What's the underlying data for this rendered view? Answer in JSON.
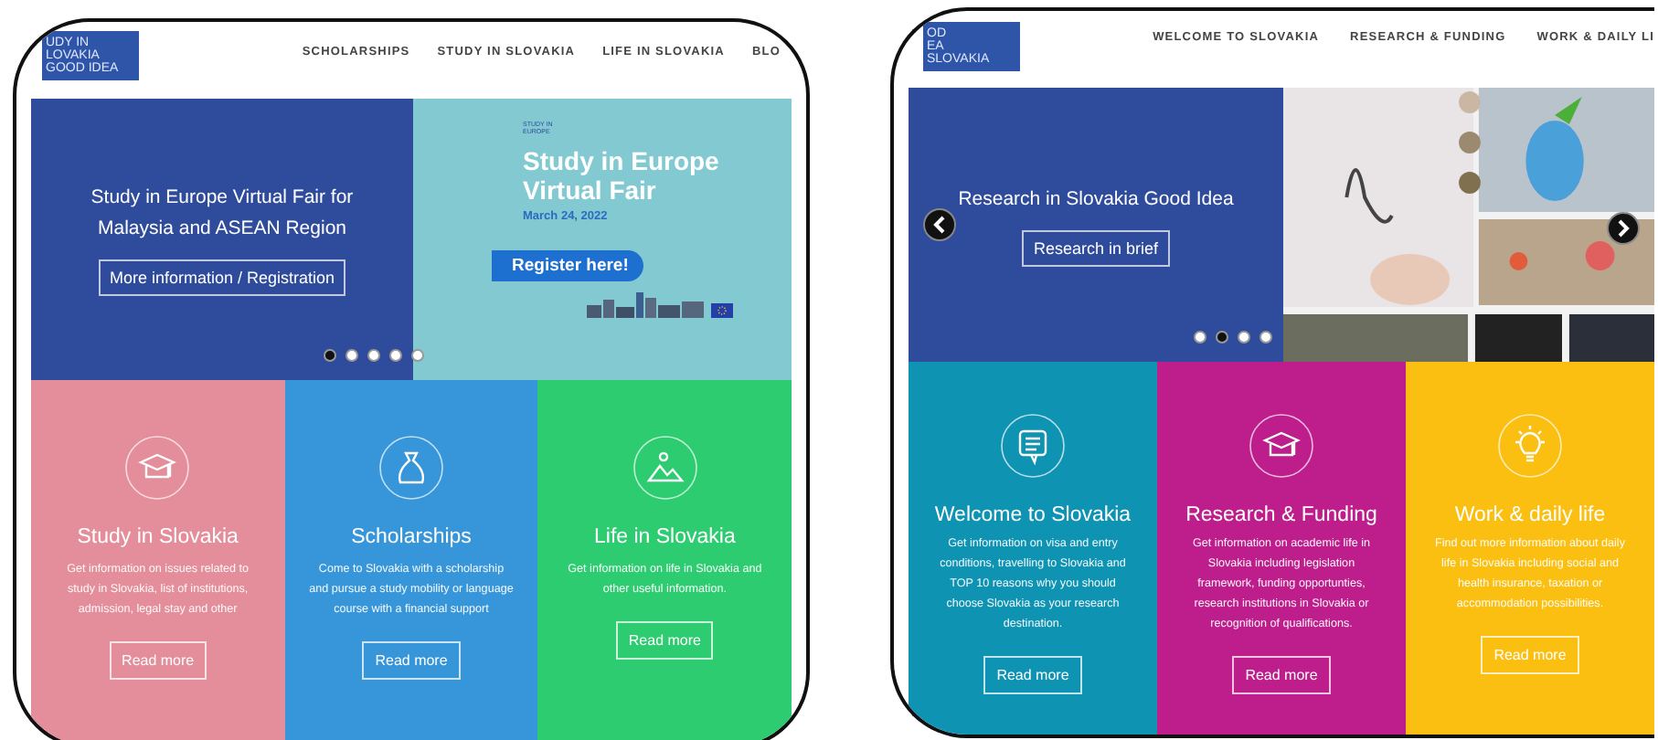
{
  "pages": [
    {
      "logo": [
        "UDY IN",
        "LOVAKIA",
        "GOOD IDEA"
      ],
      "nav": [
        "SCHOLARSHIPS",
        "STUDY IN SLOVAKIA",
        "LIFE IN SLOVAKIA",
        "BLO"
      ],
      "hero": {
        "text": "Study in Europe Virtual Fair for Malaysia and ASEAN Region",
        "button": "More information / Registration",
        "banner": {
          "logo": "STUDY IN EUROPE",
          "title": "Study in Europe Virtual Fair",
          "date": "March 24, 2022",
          "button": "Register here!"
        },
        "dots": [
          {
            "selected": true
          },
          {
            "selected": false
          },
          {
            "selected": false
          },
          {
            "selected": false
          },
          {
            "selected": false
          }
        ]
      },
      "cards": [
        {
          "title": "Study in Slovakia",
          "text": "Get information on issues related to study in Slovakia, list of institutions, admission, legal stay and other",
          "button": "Read more",
          "color": "#e48d9b"
        },
        {
          "title": "Scholarships",
          "text": "Come to Slovakia with a scholarship and pursue a study mobility or language course with a financial support",
          "button": "Read more",
          "color": "#3796d9"
        },
        {
          "title": "Life in Slovakia",
          "text": "Get information on life in Slovakia and other useful information.",
          "button": "Read more",
          "color": "#2ecc71"
        }
      ]
    },
    {
      "logo": [
        "OD",
        "EA",
        "SLOVAKIA"
      ],
      "nav": [
        "WELCOME TO SLOVAKIA",
        "RESEARCH & FUNDING",
        "WORK & DAILY LI"
      ],
      "hero": {
        "text": "Research in Slovakia Good Idea",
        "button": "Research in brief",
        "dots": [
          {
            "selected": false
          },
          {
            "selected": true
          },
          {
            "selected": false
          },
          {
            "selected": false
          }
        ]
      },
      "cards": [
        {
          "title": "Welcome to Slovakia",
          "text": "Get information on visa and entry conditions, travelling to Slovakia and TOP 10 reasons why you should choose Slovakia as your research destination.",
          "button": "Read more",
          "color": "#0e93b3"
        },
        {
          "title": "Research & Funding",
          "text": "Get information on academic life in Slovakia including legislation framework, funding opportunties, research institutions in Slovakia or recognition of qualifications.",
          "button": "Read more",
          "color": "#be1e8c"
        },
        {
          "title": "Work & daily life",
          "text": "Find out more information about daily life in Slovakia including social and health insurance, taxation or accommodation possibilities.",
          "button": "Read more",
          "color": "#fbbf12"
        }
      ]
    }
  ]
}
